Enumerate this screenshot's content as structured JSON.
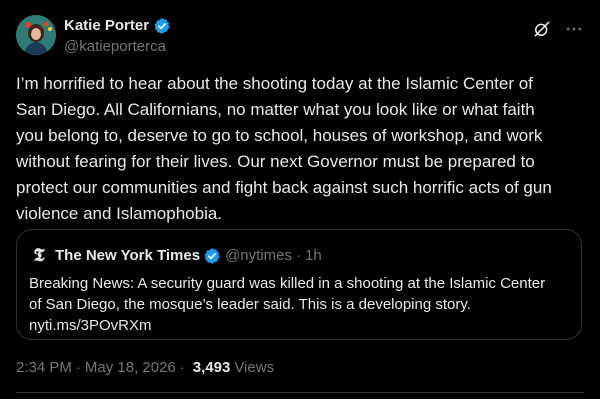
{
  "author": {
    "name": "Katie Porter",
    "handle": "@katieporterca"
  },
  "post": {
    "text": "I’m horrified to hear about the shooting today at the Islamic Center of\nSan Diego. All Californians, no matter what you look like or what faith\nyou belong to, deserve to go to school, houses of workshop, and work\nwithout fearing for their lives. Our next Governor must be prepared to\nprotect our communities and fight back against such horrific acts of gun\nviolence and Islamophobia."
  },
  "quote": {
    "name": "The New York Times",
    "handle": "@nytimes",
    "separator": "·",
    "age": "1h",
    "text_line1": "Breaking News: A security guard was killed in a shooting at the Islamic Center",
    "text_line2": "of San Diego, the mosque’s leader said. This is a developing story.",
    "link": "nyti.ms/3POvRXm"
  },
  "meta": {
    "time": "2:34 PM",
    "separator": "·",
    "date": "May 18, 2026",
    "views_count": "3,493",
    "views_label": "Views"
  },
  "icons": {
    "verified": "verified-badge-icon",
    "grok": "grok-icon",
    "more": "more-icon",
    "nyt": "nyt-logo-icon"
  },
  "colors": {
    "background": "#000000",
    "text": "#e7e9ea",
    "secondary": "#71767b",
    "verified": "#1d9bf0",
    "border": "#2f3336"
  }
}
